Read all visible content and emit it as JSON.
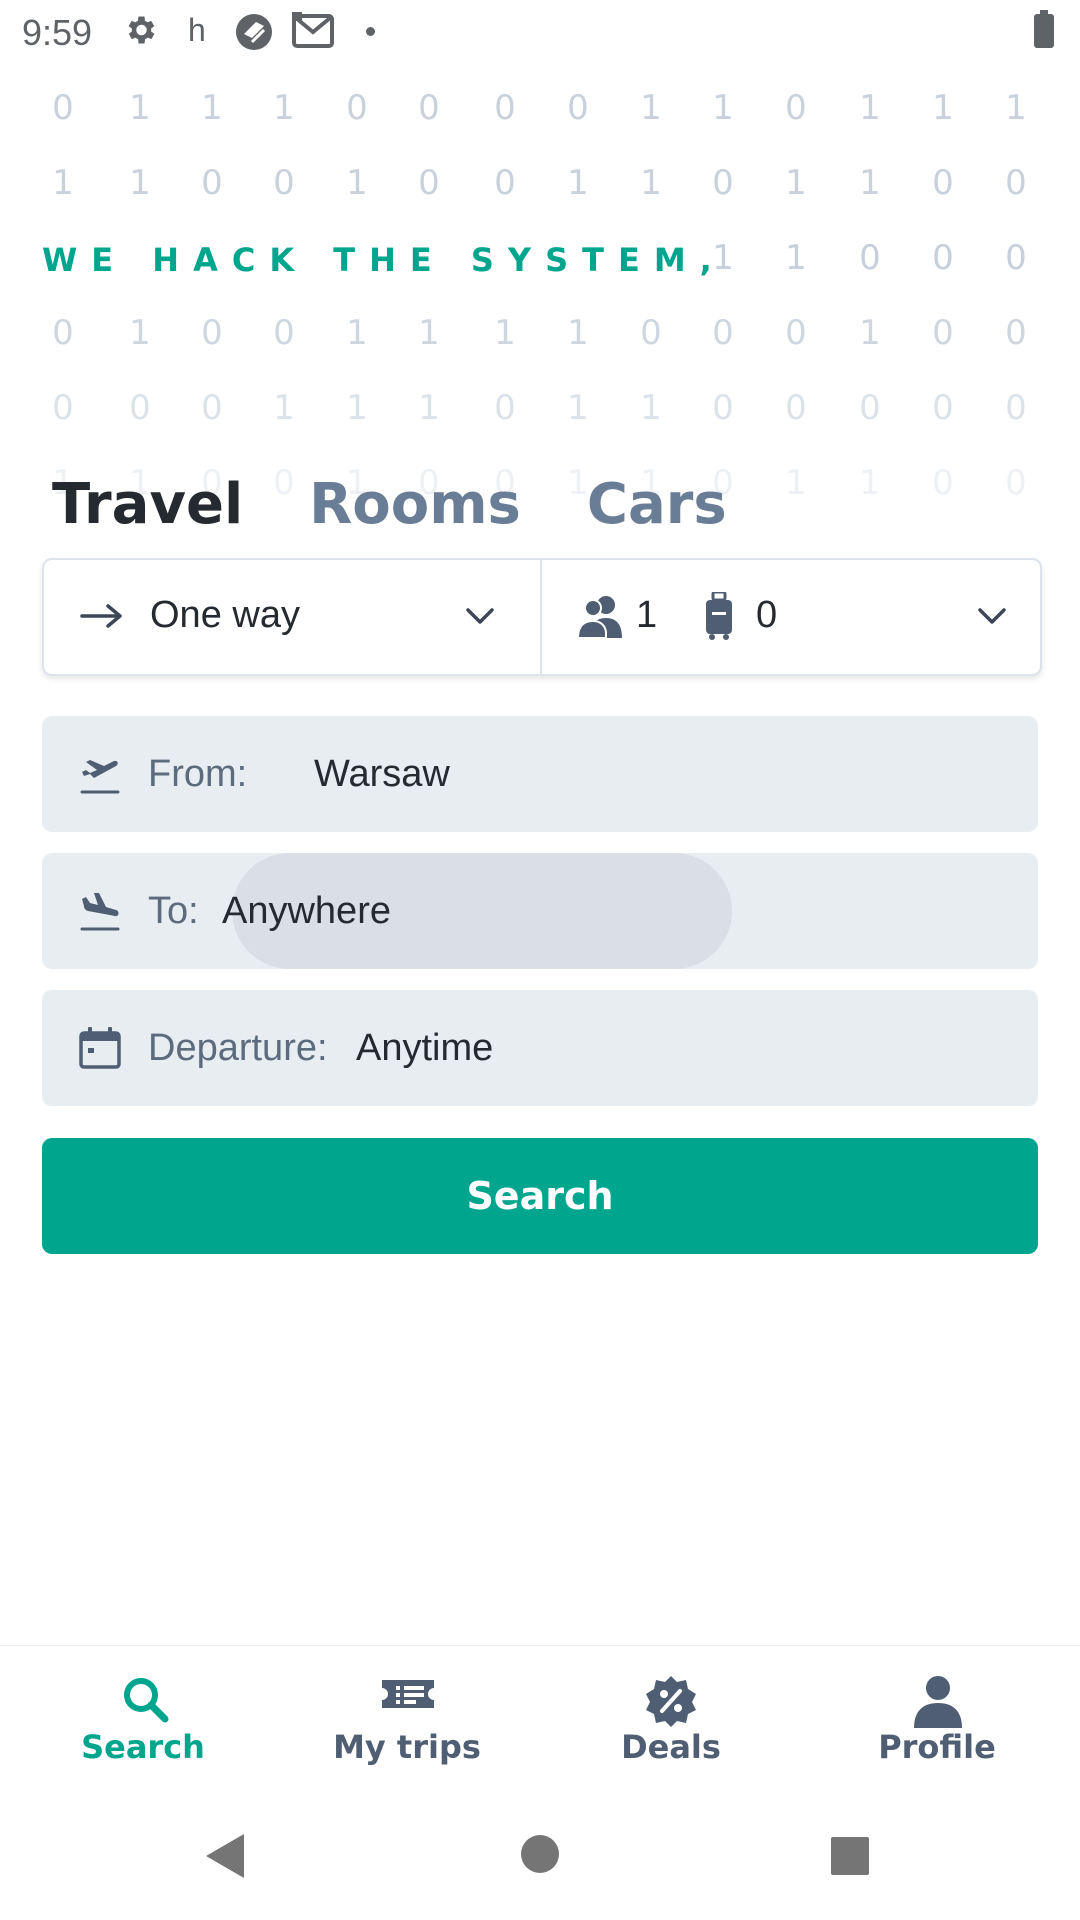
{
  "status_bar": {
    "time": "9:59",
    "letter": "h"
  },
  "binary_rows": [
    [
      "0",
      "1",
      "1",
      "1",
      "0",
      "0",
      "0",
      "0",
      "1",
      "1",
      "0",
      "1",
      "1",
      "1"
    ],
    [
      "1",
      "1",
      "0",
      "0",
      "1",
      "0",
      "0",
      "1",
      "1",
      "0",
      "1",
      "1",
      "0",
      "0"
    ],
    [
      "",
      "",
      "",
      "",
      "",
      "",
      "",
      "",
      "",
      "1",
      "1",
      "0",
      "0",
      "0"
    ],
    [
      "0",
      "1",
      "0",
      "0",
      "1",
      "1",
      "1",
      "1",
      "0",
      "0",
      "0",
      "1",
      "0",
      "0"
    ],
    [
      "0",
      "0",
      "0",
      "1",
      "1",
      "1",
      "0",
      "1",
      "1",
      "0",
      "0",
      "0",
      "0",
      "0"
    ],
    [
      "1",
      "1",
      "0",
      "0",
      "1",
      "0",
      "0",
      "1",
      "1",
      "0",
      "1",
      "1",
      "0",
      "0"
    ]
  ],
  "slogan": "WE HACK THE SYSTEM,",
  "tabs": [
    "Travel",
    "Rooms",
    "Cars"
  ],
  "options": {
    "trip_type": "One way",
    "passengers": "1",
    "bags": "0"
  },
  "fields": {
    "from_label": "From:",
    "from_value": "Warsaw",
    "to_label": "To:",
    "to_value": "Anywhere",
    "departure_label": "Departure:",
    "departure_value": "Anytime"
  },
  "search_button": "Search",
  "bottom_nav": [
    "Search",
    "My trips",
    "Deals",
    "Profile"
  ],
  "colors": {
    "accent": "#00a58e",
    "tab_inactive": "#6a7d96",
    "field_bg": "#e8edf1"
  }
}
